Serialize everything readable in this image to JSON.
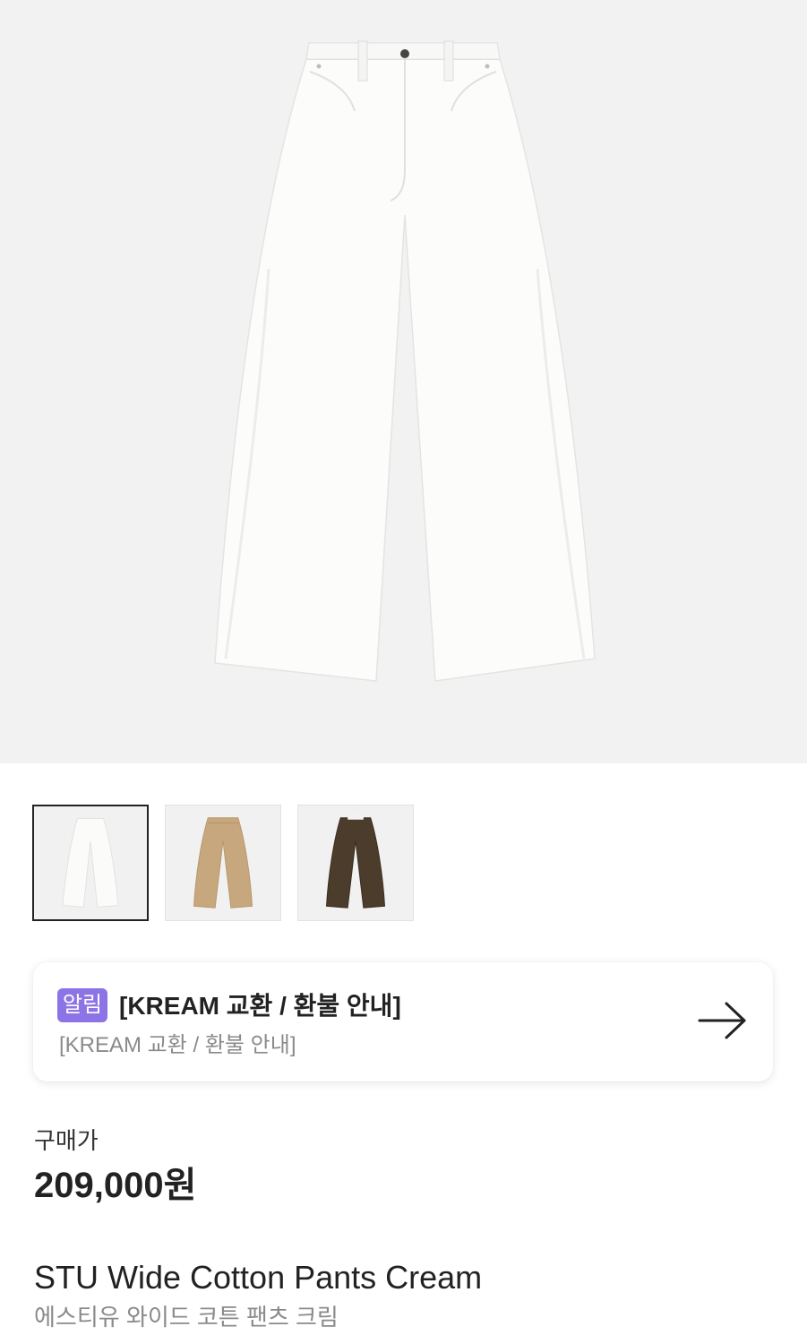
{
  "hero": {
    "image": "pants-cream-icon",
    "bg_color": "#f2f2f2"
  },
  "thumbnails": [
    {
      "color_name": "cream",
      "color": "#f7f7f5",
      "selected": true
    },
    {
      "color_name": "beige",
      "color": "#c7a77d",
      "selected": false
    },
    {
      "color_name": "brown",
      "color": "#4c3c2c",
      "selected": false
    }
  ],
  "notice": {
    "badge": "알림",
    "badge_color": "#8c73e6",
    "title": "[KREAM 교환 / 환불 안내]",
    "subtitle": "[KREAM 교환 / 환불 안내]",
    "arrow_icon": "arrow-right-icon"
  },
  "price": {
    "label": "구매가",
    "value": "209,000원"
  },
  "product": {
    "name": "STU Wide Cotton Pants Cream",
    "name_ko": "에스티유 와이드 코튼 팬츠 크림"
  }
}
